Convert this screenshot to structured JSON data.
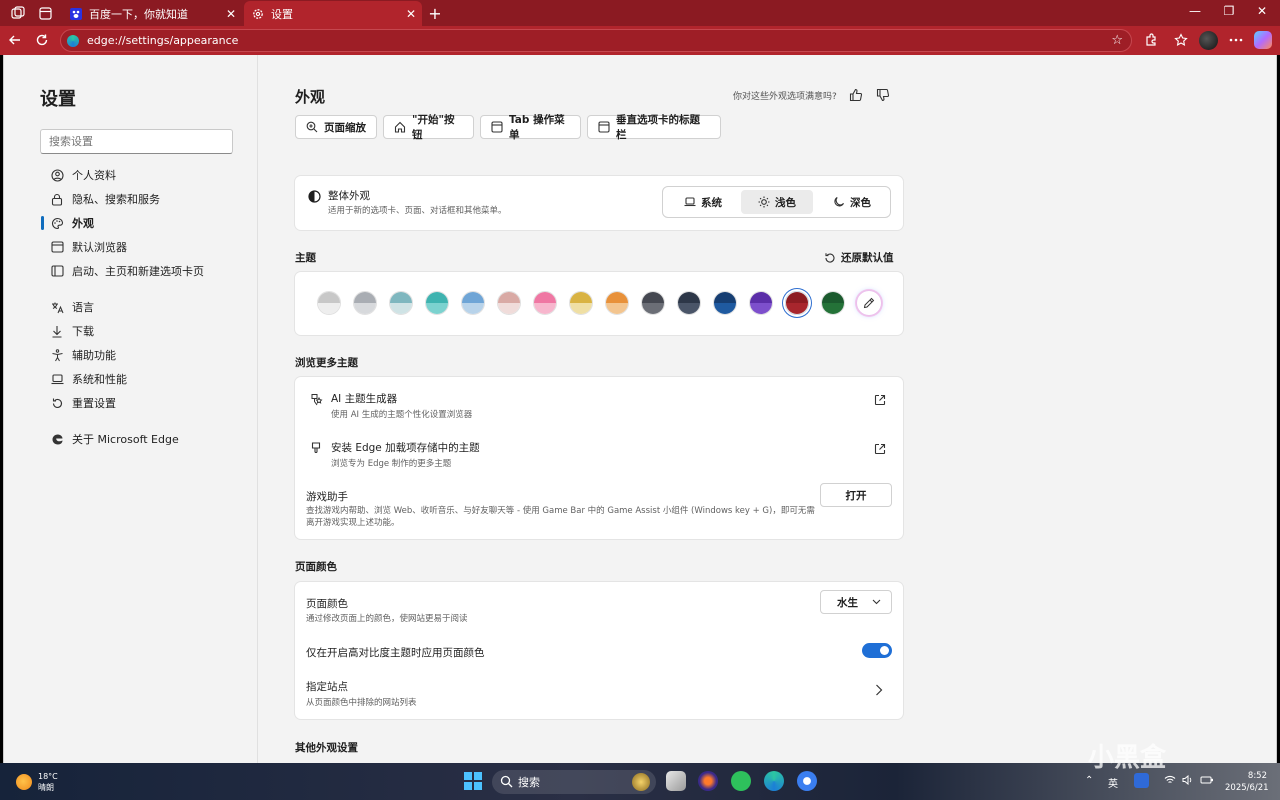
{
  "browser": {
    "tabs": [
      {
        "title": "百度一下，你就知道",
        "active": false
      },
      {
        "title": "设置",
        "active": true
      }
    ],
    "new_tab_label": "+",
    "url": "edge://settings/appearance"
  },
  "sidebar": {
    "title": "设置",
    "search_placeholder": "搜索设置",
    "items": [
      {
        "label": "个人资料",
        "icon": "profile-icon"
      },
      {
        "label": "隐私、搜索和服务",
        "icon": "lock-icon"
      },
      {
        "label": "外观",
        "icon": "appearance-icon",
        "active": true
      },
      {
        "label": "默认浏览器",
        "icon": "browser-icon"
      },
      {
        "label": "启动、主页和新建选项卡页",
        "icon": "home-tab-icon"
      },
      {
        "label": "语言",
        "icon": "language-icon"
      },
      {
        "label": "下载",
        "icon": "download-icon"
      },
      {
        "label": "辅助功能",
        "icon": "accessibility-icon"
      },
      {
        "label": "系统和性能",
        "icon": "laptop-icon"
      },
      {
        "label": "重置设置",
        "icon": "reset-icon"
      },
      {
        "label": "关于 Microsoft Edge",
        "icon": "edge-icon"
      }
    ]
  },
  "main": {
    "title": "外观",
    "feedback_question": "你对这些外观选项满意吗?",
    "chips": [
      {
        "label": "页面缩放",
        "icon": "zoom-icon"
      },
      {
        "label": "\"开始\"按钮",
        "icon": "home-icon"
      },
      {
        "label": "Tab 操作菜单",
        "icon": "tab-menu-icon"
      },
      {
        "label": "垂直选项卡的标题栏",
        "icon": "vertical-tabs-icon"
      }
    ],
    "overall": {
      "title": "整体外观",
      "subtitle": "适用于新的选项卡、页面、对话框和其他菜单。",
      "options": [
        {
          "label": "系统",
          "icon": "laptop-icon"
        },
        {
          "label": "浅色",
          "icon": "sun-icon",
          "selected": true
        },
        {
          "label": "深色",
          "icon": "moon-icon"
        }
      ]
    },
    "theme": {
      "title": "主题",
      "reset_label": "还原默认值",
      "swatches": [
        {
          "top": "#c8c8c8",
          "bottom": "#eeeeee"
        },
        {
          "top": "#a9adb3",
          "bottom": "#d7d9dc"
        },
        {
          "top": "#7fb7bf",
          "bottom": "#cfe3e5"
        },
        {
          "top": "#3fb3b0",
          "bottom": "#7cd2cf"
        },
        {
          "top": "#6fa5d6",
          "bottom": "#b8d3ea"
        },
        {
          "top": "#d9aaa5",
          "bottom": "#f0dcda"
        },
        {
          "top": "#ef77a3",
          "bottom": "#f7b6cd"
        },
        {
          "top": "#d9b343",
          "bottom": "#efdfa4"
        },
        {
          "top": "#e8913a",
          "bottom": "#f3c58f"
        },
        {
          "top": "#454851",
          "bottom": "#6b6e76"
        },
        {
          "top": "#2d3748",
          "bottom": "#4a5568"
        },
        {
          "top": "#163e72",
          "bottom": "#1f5aa0"
        },
        {
          "top": "#5b2ea8",
          "bottom": "#7d4fcc"
        },
        {
          "top": "#8c1c22",
          "bottom": "#a8262d",
          "selected": true
        },
        {
          "top": "#1b5a2e",
          "bottom": "#247238"
        }
      ],
      "custom_icon": "eyedropper-icon"
    },
    "more_themes": {
      "title": "浏览更多主题",
      "rows": [
        {
          "title": "AI 主题生成器",
          "subtitle": "使用 AI 生成的主题个性化设置浏览器"
        },
        {
          "title": "安装 Edge 加载项存储中的主题",
          "subtitle": "浏览专为 Edge 制作的更多主题"
        }
      ],
      "game": {
        "title": "游戏助手",
        "subtitle_line1": "查找游戏内帮助、浏览 Web、收听音乐、与好友聊天等 - 使用 Game Bar 中的 Game Assist 小组件 (Windows key + G)，即可无需",
        "subtitle_line2": "离开游戏实现上述功能。",
        "button": "打开"
      }
    },
    "page_color": {
      "title": "页面颜色",
      "row1_title": "页面颜色",
      "row1_sub": "通过修改页面上的颜色，使网站更易于阅读",
      "select_value": "水生",
      "row2_title": "仅在开启高对比度主题时应用页面颜色",
      "row3_title": "指定站点",
      "row3_sub": "从页面颜色中排除的网站列表"
    },
    "other_title": "其他外观设置"
  },
  "taskbar": {
    "temp": "18°C",
    "weather": "晴朗",
    "search": "搜索",
    "ime": "英",
    "time": "8:52",
    "date": "2025/6/21"
  },
  "watermark": "小黑盒",
  "colors": {
    "frame": "#8b1a22",
    "accent": "#1f6fd6"
  }
}
